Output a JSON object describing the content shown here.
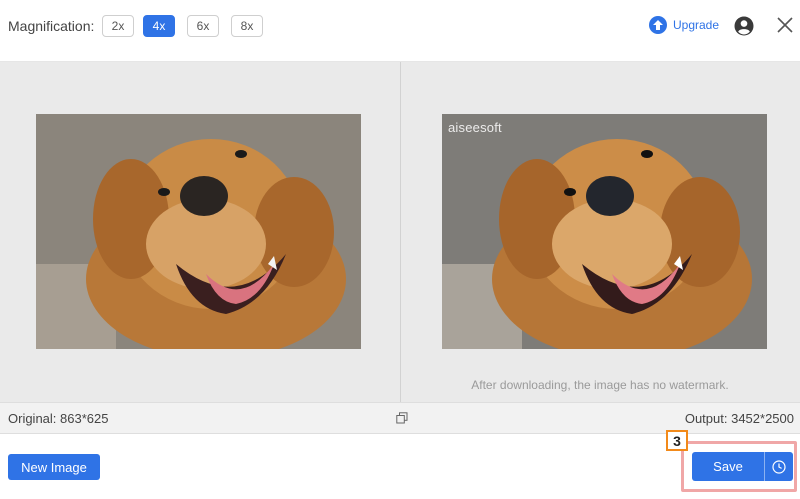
{
  "toolbar": {
    "magnification_label": "Magnification:",
    "options": [
      "2x",
      "4x",
      "6x",
      "8x"
    ],
    "selected": "4x",
    "upgrade_label": "Upgrade",
    "accent_color": "#2f73e6"
  },
  "preview": {
    "left_image_icon": "dog-photo-original",
    "right_image_icon": "dog-photo-enhanced",
    "watermark": "aiseesoft",
    "note": "After downloading, the image has no watermark."
  },
  "info": {
    "original": "Original: 863*625",
    "output": "Output: 3452*2500"
  },
  "footer": {
    "new_image_label": "New Image",
    "save_label": "Save",
    "step_badge": "3",
    "highlight_color": "#f0a7a7",
    "badge_color": "#f28a1a"
  }
}
